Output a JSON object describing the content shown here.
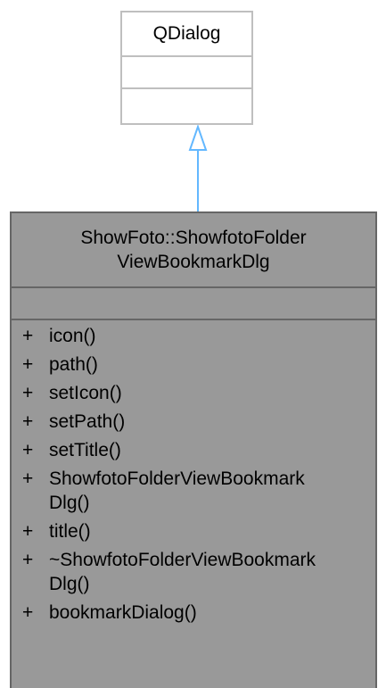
{
  "parent": {
    "name": "QDialog"
  },
  "child": {
    "name_line1": "ShowFoto::ShowfotoFolder",
    "name_line2": "ViewBookmarkDlg",
    "operations": [
      {
        "visibility": "+",
        "name": "icon()"
      },
      {
        "visibility": "+",
        "name": "path()"
      },
      {
        "visibility": "+",
        "name": "setIcon()"
      },
      {
        "visibility": "+",
        "name": "setPath()"
      },
      {
        "visibility": "+",
        "name": "setTitle()"
      },
      {
        "visibility": "+",
        "name": "ShowfotoFolderViewBookmark\nDlg()"
      },
      {
        "visibility": "+",
        "name": "title()"
      },
      {
        "visibility": "+",
        "name": "~ShowfotoFolderViewBookmark\nDlg()"
      },
      {
        "visibility": "+",
        "name": "bookmarkDialog()"
      }
    ]
  },
  "colors": {
    "parent_border": "#bfbfbf",
    "child_fill": "#999999",
    "child_border": "#666666",
    "inheritance_arrow": "#63b8ff"
  }
}
